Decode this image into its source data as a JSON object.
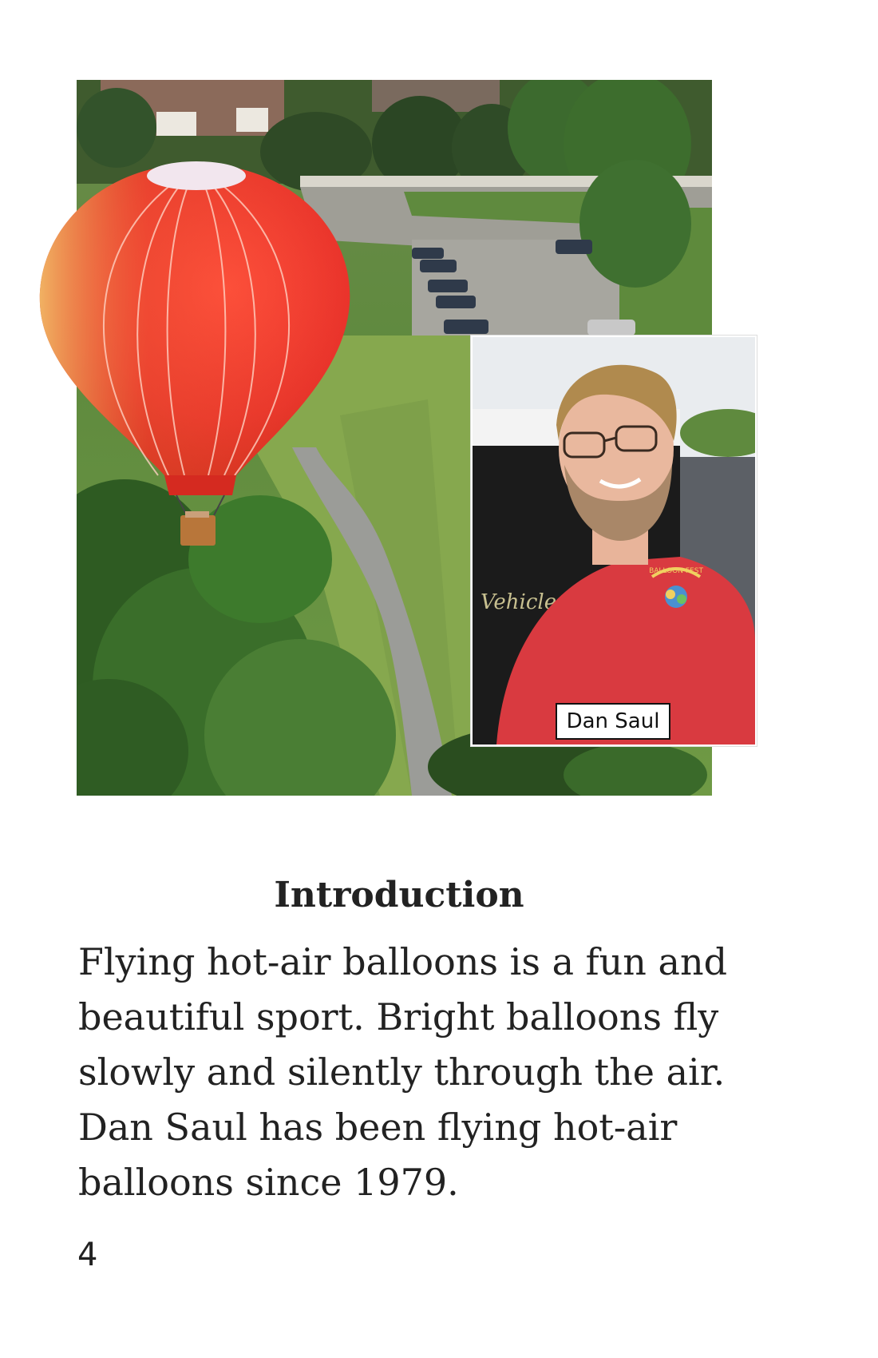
{
  "photo": {
    "main_subject": "red hot-air balloon over trees and parking lot",
    "inset_caption": "Dan Saul",
    "shirt_text": "BALLOON FEST",
    "van_text": "Vehicle"
  },
  "section": {
    "heading": "Introduction",
    "paragraph": "Flying hot-air balloons is a fun and beautiful sport. Bright balloons fly slowly and silently through the air. Dan Saul has been flying hot-air balloons since 1979."
  },
  "page": {
    "number": "4"
  },
  "colors": {
    "balloon_red": "#e8322a",
    "shirt_red": "#d93a40",
    "grass": "#6f9a45",
    "road": "#a9a9a3",
    "text": "#222222"
  }
}
